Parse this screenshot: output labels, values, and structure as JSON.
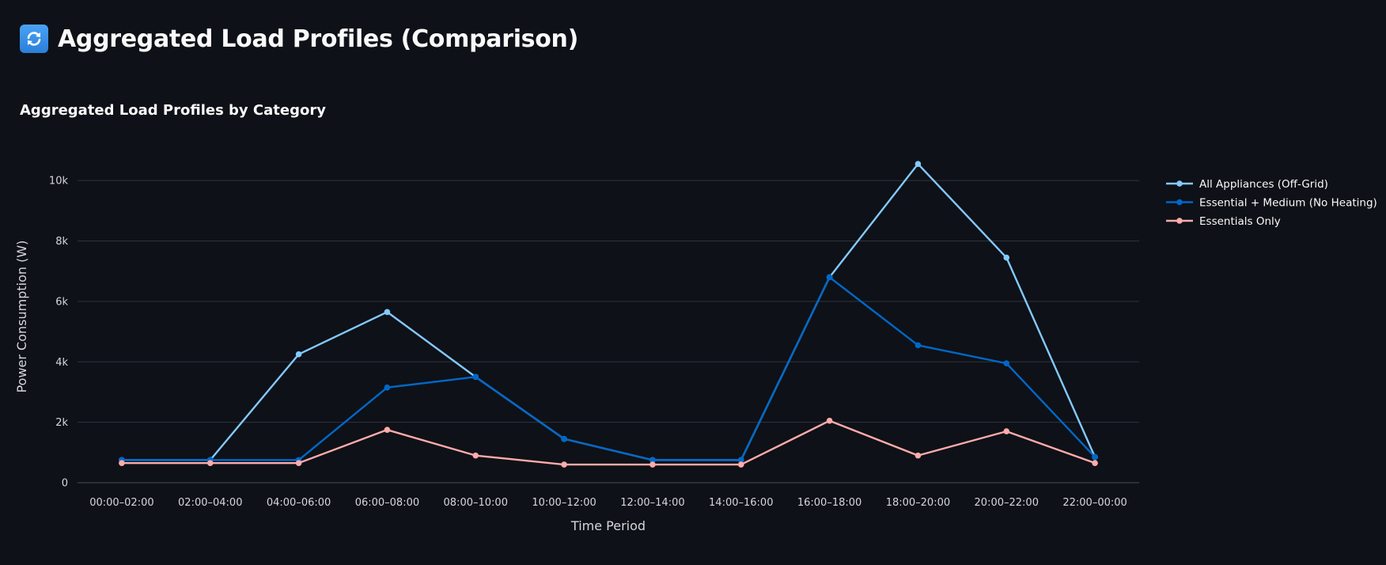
{
  "header": {
    "title": "Aggregated Load Profiles (Comparison)",
    "icon": "arrows-counterclockwise-icon"
  },
  "colors": {
    "background": "#0e1117",
    "grid": "#31333f",
    "text": "#fafafa"
  },
  "chart_data": {
    "type": "line",
    "title": "Aggregated Load Profiles by Category",
    "xlabel": "Time Period",
    "ylabel": "Power Consumption (W)",
    "categories": [
      "00:00–02:00",
      "02:00–04:00",
      "04:00–06:00",
      "06:00–08:00",
      "08:00–10:00",
      "10:00–12:00",
      "12:00–14:00",
      "14:00–16:00",
      "16:00–18:00",
      "18:00–20:00",
      "20:00–22:00",
      "22:00–00:00"
    ],
    "ylim": [
      0,
      11000
    ],
    "yticks": [
      0,
      2000,
      4000,
      6000,
      8000,
      10000
    ],
    "ytick_labels": [
      "0",
      "2k",
      "4k",
      "6k",
      "8k",
      "10k"
    ],
    "grid": true,
    "legend_position": "right",
    "series": [
      {
        "name": "All Appliances (Off-Grid)",
        "color": "#83c9ff",
        "values": [
          750,
          750,
          4250,
          5650,
          3500,
          1450,
          750,
          750,
          6800,
          10550,
          7450,
          850
        ]
      },
      {
        "name": "Essential + Medium (No Heating)",
        "color": "#0068c9",
        "values": [
          750,
          750,
          750,
          3150,
          3500,
          1450,
          750,
          750,
          6800,
          4550,
          3950,
          850
        ]
      },
      {
        "name": "Essentials Only",
        "color": "#ffabab",
        "values": [
          650,
          650,
          650,
          1750,
          900,
          600,
          600,
          600,
          2050,
          900,
          1700,
          650
        ]
      }
    ]
  }
}
